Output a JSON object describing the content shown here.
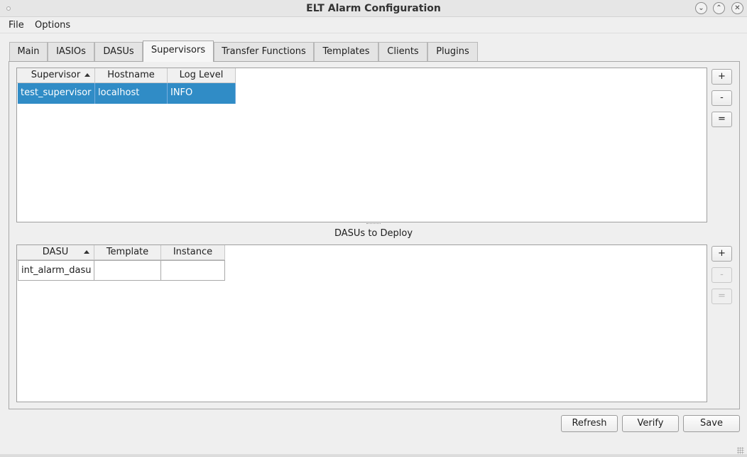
{
  "window": {
    "title": "ELT Alarm Configuration",
    "controls": [
      "chevron-down-icon",
      "chevron-up-icon",
      "close-icon"
    ]
  },
  "menu": {
    "file": "File",
    "options": "Options"
  },
  "tabs": [
    {
      "label": "Main"
    },
    {
      "label": "IASIOs"
    },
    {
      "label": "DASUs"
    },
    {
      "label": "Supervisors"
    },
    {
      "label": "Transfer Functions"
    },
    {
      "label": "Templates"
    },
    {
      "label": "Clients"
    },
    {
      "label": "Plugins"
    }
  ],
  "active_tab": "Supervisors",
  "supervisors_table": {
    "columns": [
      "Supervisor",
      "Hostname",
      "Log Level"
    ],
    "sorted_column": "Supervisor",
    "rows": [
      {
        "supervisor": "test_supervisor",
        "hostname": "localhost",
        "log_level": "INFO",
        "selected": true
      }
    ],
    "buttons": {
      "add": "+",
      "remove": "-",
      "edit": "="
    }
  },
  "dasus_section": {
    "label": "DASUs to Deploy",
    "columns": [
      "DASU",
      "Template",
      "Instance"
    ],
    "sorted_column": "DASU",
    "rows": [
      {
        "dasu": "int_alarm_dasu",
        "template": "",
        "instance": ""
      }
    ],
    "buttons": {
      "add": "+",
      "remove": "-",
      "edit": "="
    }
  },
  "footer": {
    "refresh": "Refresh",
    "verify": "Verify",
    "save": "Save"
  }
}
